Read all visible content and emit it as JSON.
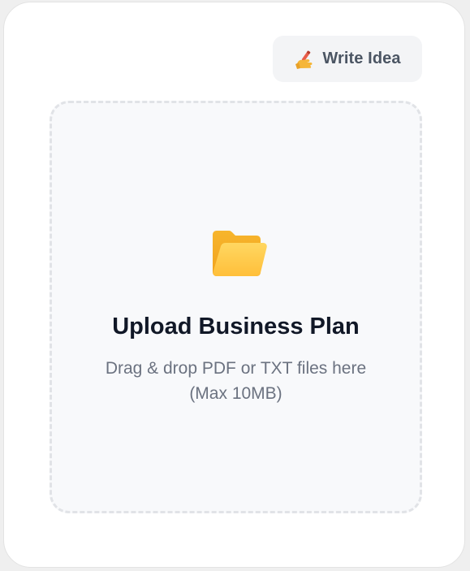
{
  "write_button": {
    "icon": "writing-hand-icon",
    "label": "Write Idea"
  },
  "upload": {
    "icon": "folder-icon",
    "title": "Upload Business Plan",
    "description_line1": "Drag & drop PDF or TXT files here",
    "description_line2": "(Max 10MB)"
  },
  "colors": {
    "folder_accent": "#FFB833",
    "title": "#111827",
    "muted_text": "#6B7280",
    "button_bg": "#F3F4F6"
  }
}
